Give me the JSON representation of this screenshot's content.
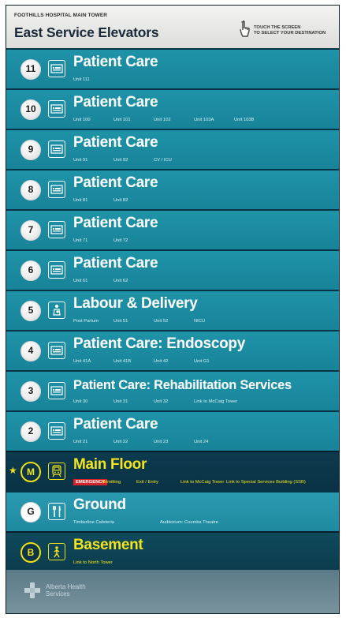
{
  "header": {
    "subtitle": "FOOTHILLS HOSPITAL MAIN TOWER",
    "title": "East Service Elevators",
    "touch_line1": "TOUCH THE SCREEN",
    "touch_line2": "TO SELECT YOUR DESTINATION"
  },
  "floors": [
    {
      "id": "11",
      "title": "Patient Care",
      "icon": "bed-icon",
      "units": [
        "Unit 111"
      ]
    },
    {
      "id": "10",
      "title": "Patient Care",
      "icon": "bed-icon",
      "units": [
        "Unit 100",
        "Unit 101",
        "Unit 102",
        "Unit 103A",
        "Unit 103B"
      ]
    },
    {
      "id": "9",
      "title": "Patient Care",
      "icon": "bed-icon",
      "units": [
        "Unit 91",
        "Unit 92",
        "CV / ICU"
      ]
    },
    {
      "id": "8",
      "title": "Patient Care",
      "icon": "bed-icon",
      "units": [
        "Unit 81",
        "Unit 82"
      ]
    },
    {
      "id": "7",
      "title": "Patient Care",
      "icon": "bed-icon",
      "units": [
        "Unit 71",
        "Unit 72"
      ]
    },
    {
      "id": "6",
      "title": "Patient Care",
      "icon": "bed-icon",
      "units": [
        "Unit 61",
        "Unit 62"
      ]
    },
    {
      "id": "5",
      "title": "Labour & Delivery",
      "icon": "mother-baby-icon",
      "units": [
        "Post Partum",
        "Unit 51",
        "Unit 52",
        "NICU"
      ]
    },
    {
      "id": "4",
      "title": "Patient Care: Endoscopy",
      "icon": "bed-icon",
      "units": [
        "Unit 41A",
        "Unit 41B",
        "Unit 42",
        "Unit G1"
      ]
    },
    {
      "id": "3",
      "title": "Patient Care: Rehabilitation Services",
      "icon": "bed-icon",
      "units": [
        "Unit 30",
        "Unit 31",
        "Unit 32",
        "Link to McCaig Tower"
      ]
    },
    {
      "id": "2",
      "title": "Patient Care",
      "icon": "bed-icon",
      "units": [
        "Unit 21",
        "Unit 22",
        "Unit 23",
        "Unit 24"
      ]
    },
    {
      "id": "M",
      "title": "Main Floor",
      "icon": "train-icon",
      "current": true,
      "units": [
        "EMERGENCY",
        "Admitting",
        "Exit / Entry",
        "Link to McCaig Tower",
        "Link to Special Services Building (SSB)"
      ]
    },
    {
      "id": "G",
      "title": "Ground",
      "icon": "cafeteria-icon",
      "units": [
        "Timberline Cafeteria",
        "Auditorium: Coombs Theatre"
      ]
    },
    {
      "id": "B",
      "title": "Basement",
      "icon": "walking-person-icon",
      "units": [
        "Link to North Tower"
      ]
    }
  ],
  "footer": {
    "org_line1": "Alberta Health",
    "org_line2": "Services"
  },
  "colors": {
    "floor_teal": "#1f93a8",
    "main_floor_dark": "#0c3a4e",
    "accent_yellow": "#f4e41c",
    "emergency_red": "#d4232b"
  }
}
